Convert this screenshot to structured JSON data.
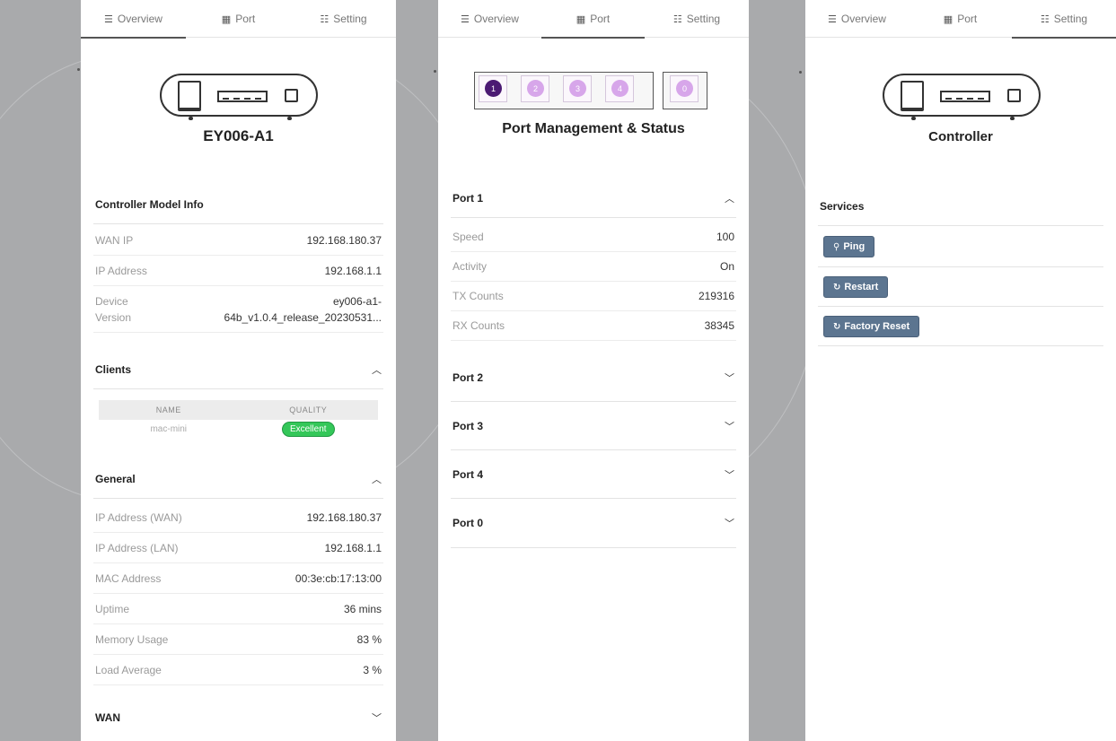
{
  "tabs": {
    "overview": "Overview",
    "port": "Port",
    "setting": "Setting"
  },
  "overview": {
    "device_name": "EY006-A1",
    "model_info_title": "Controller Model Info",
    "model_info": [
      {
        "label": "WAN IP",
        "value": "192.168.180.37"
      },
      {
        "label": "IP Address",
        "value": "192.168.1.1"
      },
      {
        "label": "Device",
        "value": "ey006-a1-"
      },
      {
        "label": "Version",
        "value": "64b_v1.0.4_release_20230531..."
      }
    ],
    "clients_title": "Clients",
    "clients_columns": [
      "NAME",
      "QUALITY"
    ],
    "clients": [
      {
        "name": "mac-mini",
        "quality": "Excellent"
      }
    ],
    "general_title": "General",
    "general": [
      {
        "label": "IP Address (WAN)",
        "value": "192.168.180.37"
      },
      {
        "label": "IP Address (LAN)",
        "value": "192.168.1.1"
      },
      {
        "label": "MAC Address",
        "value": "00:3e:cb:17:13:00"
      },
      {
        "label": "Uptime",
        "value": "36 mins"
      },
      {
        "label": "Memory Usage",
        "value": "83 %"
      },
      {
        "label": "Load Average",
        "value": "3 %"
      }
    ],
    "wan_title": "WAN"
  },
  "port": {
    "title": "Port Management & Status",
    "port_numbers": [
      "1",
      "2",
      "3",
      "4",
      "0"
    ],
    "active_port": "1",
    "port1_title": "Port 1",
    "port1_rows": [
      {
        "label": "Speed",
        "value": "100"
      },
      {
        "label": "Activity",
        "value": "On"
      },
      {
        "label": "TX Counts",
        "value": "219316"
      },
      {
        "label": "RX Counts",
        "value": "38345"
      }
    ],
    "other_ports": [
      "Port 2",
      "Port 3",
      "Port 4",
      "Port 0"
    ]
  },
  "setting": {
    "device_name": "Controller",
    "services_title": "Services",
    "buttons": [
      "Ping",
      "Restart",
      "Factory Reset"
    ]
  },
  "colors": {
    "gap_gray": "#a9aaac",
    "badge_green": "#34c759",
    "port_active": "#4b1a73",
    "port_inactive": "#d7a6ea",
    "button_blue": "#5c7590"
  },
  "icons": {
    "overview_tab": "list-icon",
    "port_tab": "grid-icon",
    "setting_tab": "sliders-icon",
    "expanded": "chevron-up-icon",
    "collapsed": "chevron-down-icon",
    "ping": "search-icon",
    "restart": "refresh-icon",
    "factory_reset": "refresh-icon"
  }
}
